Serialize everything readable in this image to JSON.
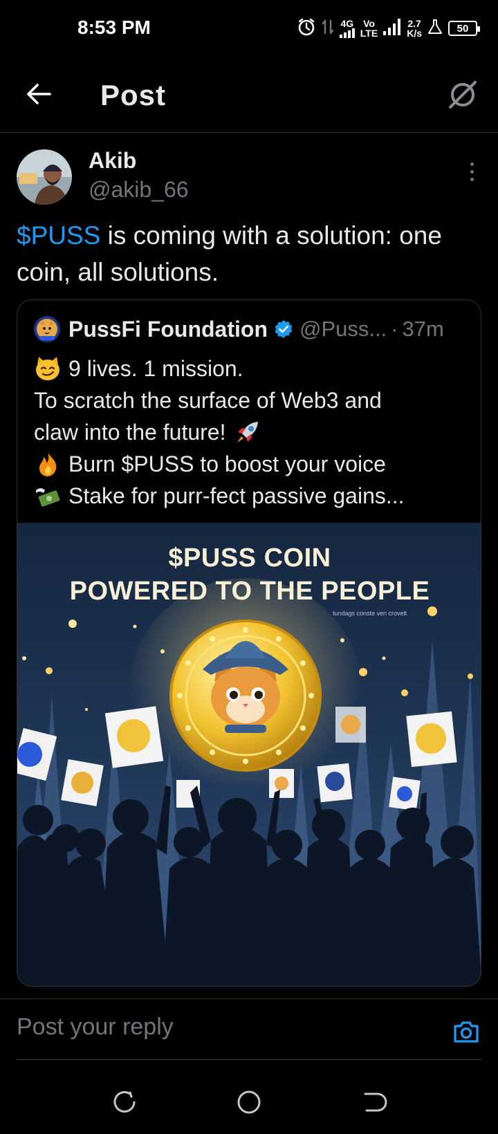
{
  "status": {
    "time": "8:53 PM",
    "network_a": "4G",
    "network_b_top": "Vo",
    "network_b_bottom": "LTE",
    "speed_top": "2.7",
    "speed_bottom": "K/s",
    "battery": "50"
  },
  "header": {
    "title": "Post"
  },
  "post": {
    "author_name": "Akib",
    "author_handle": "@akib_66",
    "cashtag": "$PUSS",
    "text_rest": " is coming with a solution: one coin, all solutions."
  },
  "quote": {
    "name": "PussFi Foundation",
    "handle": "@Puss...",
    "dot": "·",
    "time": "37m",
    "lines": {
      "l1": "9 lives. 1 mission.",
      "l2": "To scratch the surface of Web3 and",
      "l3": "claw into the future!",
      "l4": "Burn $PUSS to boost your voice",
      "l5": "Stake for purr-fect passive gains..."
    },
    "image": {
      "title1": "$PUSS COIN",
      "title2": "POWERED TO THE PEOPLE",
      "small_text": "tundags conste ven crovelt"
    }
  },
  "reply": {
    "placeholder": "Post your reply"
  },
  "colors": {
    "accent": "#1d9bf0",
    "background": "#000000",
    "secondary_text": "#71767b"
  }
}
